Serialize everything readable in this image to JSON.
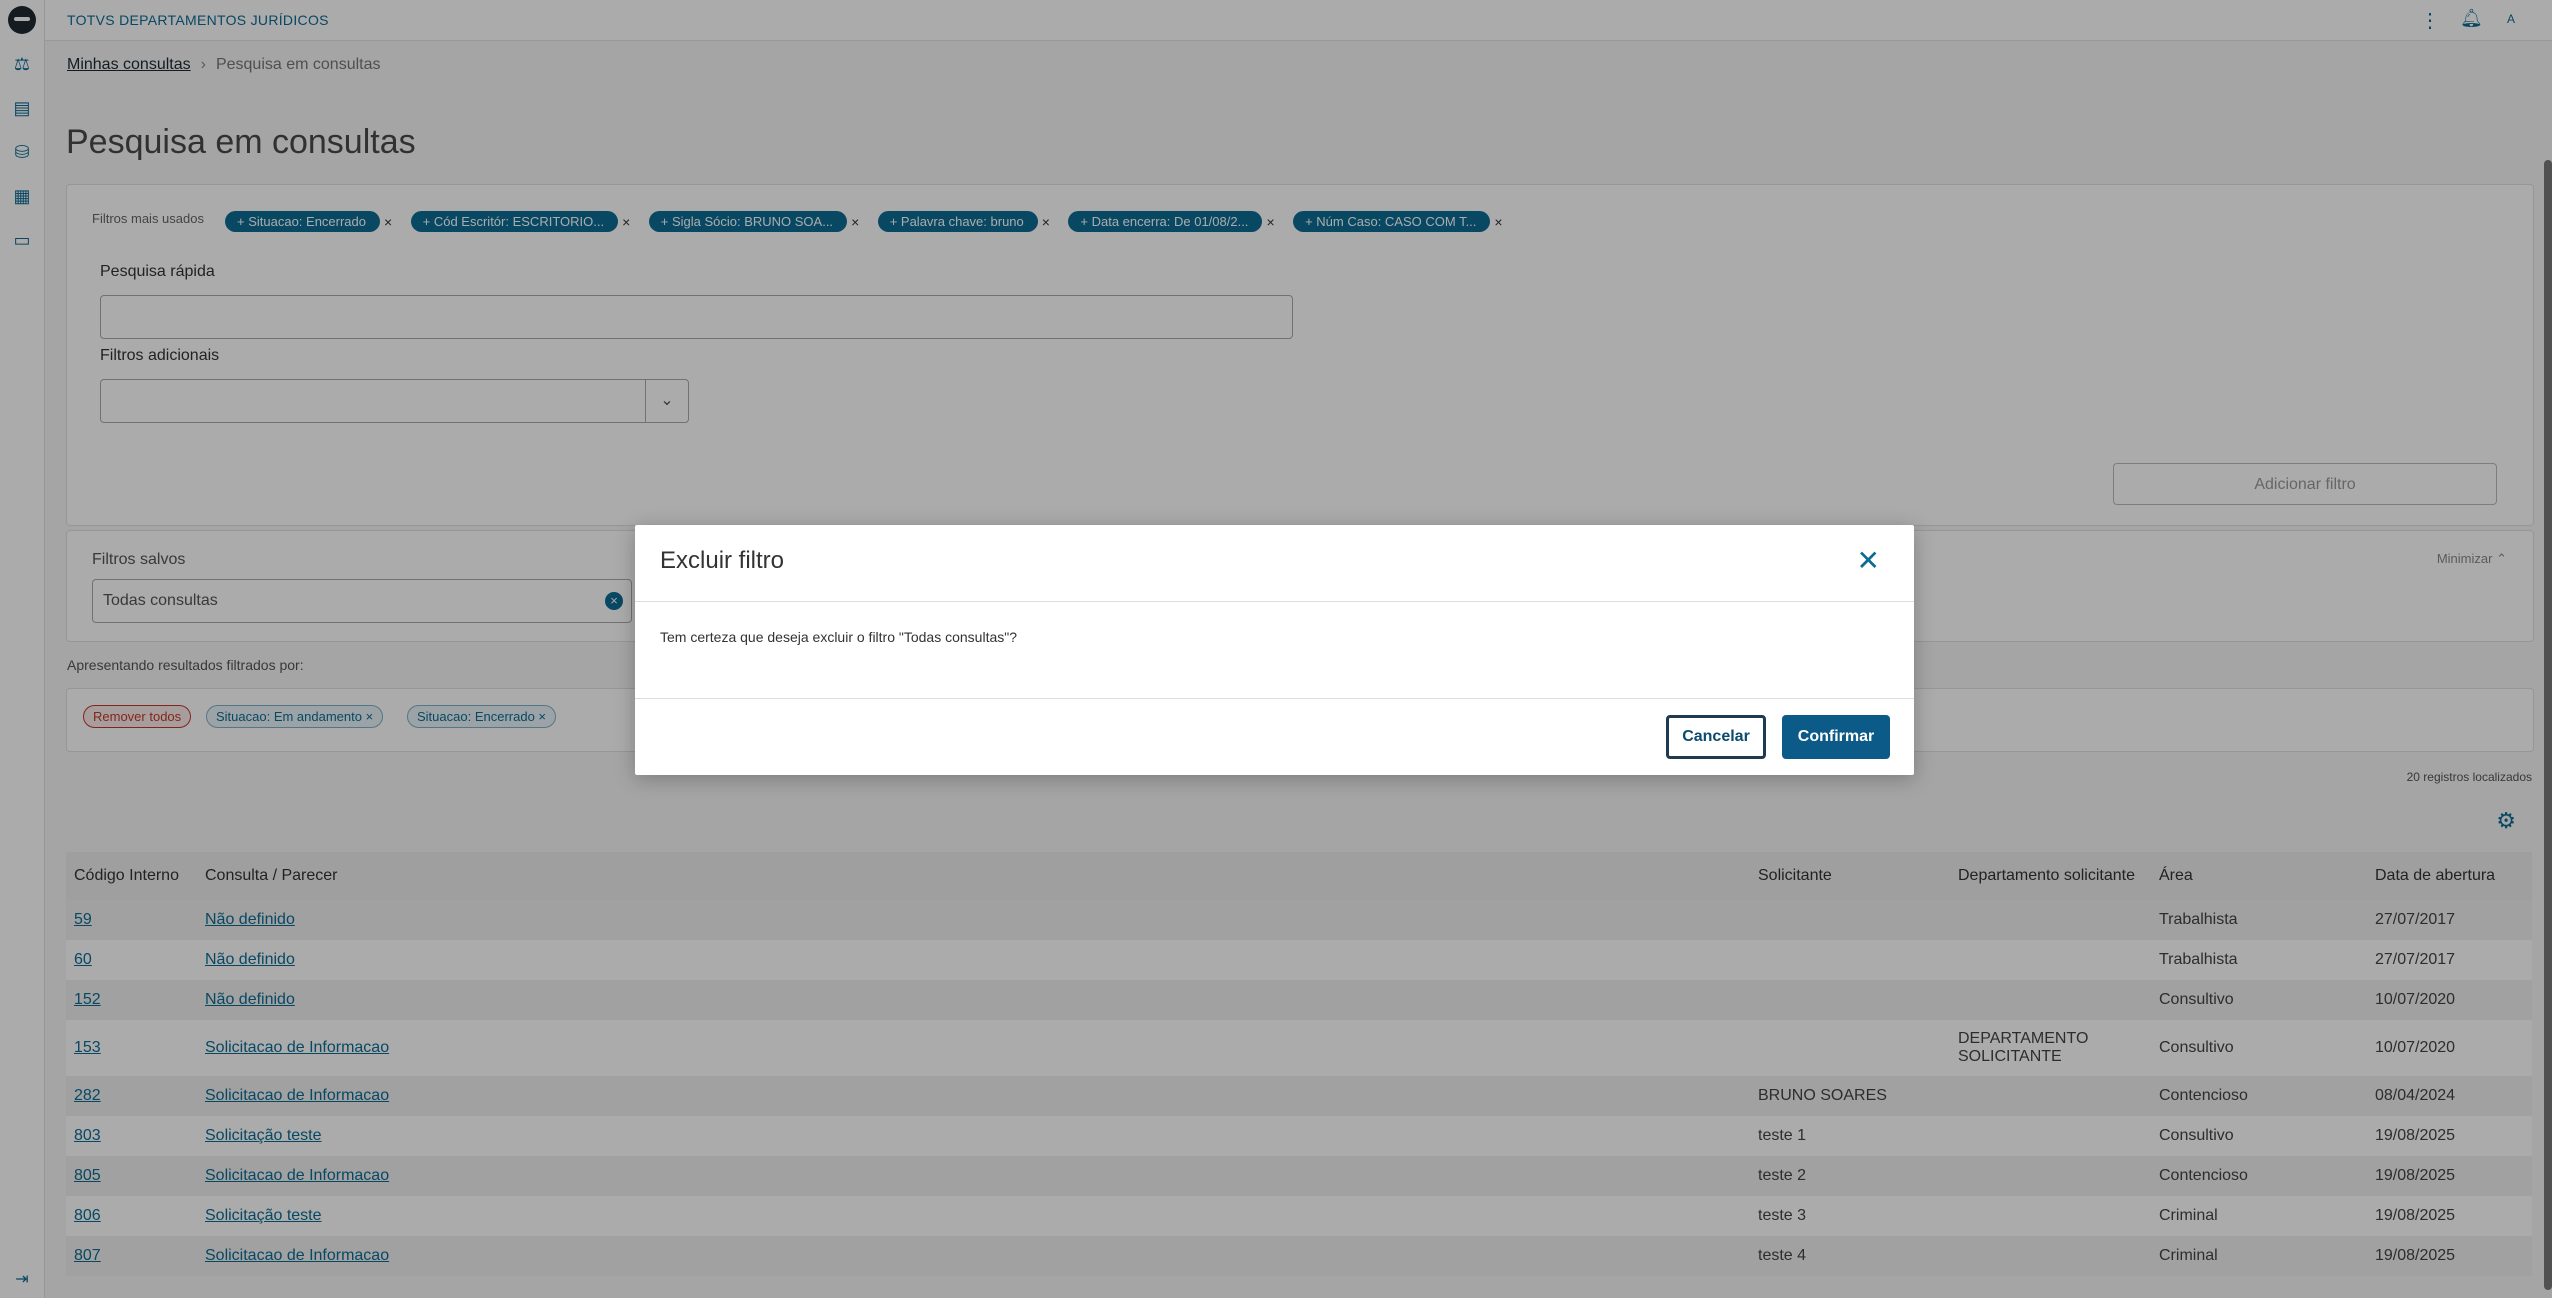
{
  "app": {
    "title": "TOTVS DEPARTAMENTOS JURÍDICOS",
    "user_initial": "A"
  },
  "breadcrumb": {
    "link": "Minhas consultas",
    "current": "Pesquisa em consultas"
  },
  "page_title": "Pesquisa em consultas",
  "filters": {
    "most_used_label": "Filtros mais usados",
    "chips": [
      "+ Situacao: Encerrado",
      "+ Cód Escritór: ESCRITORIO...",
      "+ Sigla Sócio: BRUNO SOA...",
      "+ Palavra chave: bruno",
      "+ Data encerra: De 01/08/2...",
      "+ Núm Caso: CASO COM T..."
    ],
    "quick_search_label": "Pesquisa rápida",
    "quick_search_value": "",
    "additional_label": "Filtros adicionais",
    "additional_value": "",
    "add_button": "Adicionar filtro"
  },
  "saved": {
    "label": "Filtros salvos",
    "value": "Todas consultas",
    "minimize": "Minimizar"
  },
  "results": {
    "label": "Apresentando resultados filtrados por:",
    "remove_all": "Remover todos",
    "chips": [
      "Situacao: Em andamento",
      "Situacao: Encerrado"
    ],
    "count": "20 registros localizados"
  },
  "table": {
    "headers": [
      "Código Interno",
      "Consulta / Parecer",
      "Solicitante",
      "Departamento solicitante",
      "Área",
      "Data de abertura"
    ],
    "rows": [
      [
        "59",
        "Não definido",
        "",
        "",
        "Trabalhista",
        "27/07/2017"
      ],
      [
        "60",
        "Não definido",
        "",
        "",
        "Trabalhista",
        "27/07/2017"
      ],
      [
        "152",
        "Não definido",
        "",
        "",
        "Consultivo",
        "10/07/2020"
      ],
      [
        "153",
        "Solicitacao de Informacao",
        "",
        "DEPARTAMENTO SOLICITANTE",
        "Consultivo",
        "10/07/2020"
      ],
      [
        "282",
        "Solicitacao de Informacao",
        "BRUNO SOARES",
        "",
        "Contencioso",
        "08/04/2024"
      ],
      [
        "803",
        "Solicitação teste",
        "teste 1",
        "",
        "Consultivo",
        "19/08/2025"
      ],
      [
        "805",
        "Solicitacao de Informacao",
        "teste 2",
        "",
        "Contencioso",
        "19/08/2025"
      ],
      [
        "806",
        "Solicitação teste",
        "teste 3",
        "",
        "Criminal",
        "19/08/2025"
      ],
      [
        "807",
        "Solicitacao de Informacao",
        "teste 4",
        "",
        "Criminal",
        "19/08/2025"
      ]
    ]
  },
  "modal": {
    "title": "Excluir filtro",
    "message": "Tem certeza que deseja excluir o filtro \"Todas consultas\"?",
    "cancel": "Cancelar",
    "confirm": "Confirmar"
  },
  "colors": {
    "primary": "#0c6c94",
    "confirm": "#0c5a88",
    "danger": "#c0392b"
  },
  "icons": [
    "scale-icon",
    "report-icon",
    "database-icon",
    "building-icon",
    "document-icon",
    "collapse-menu-icon",
    "more-vertical-icon",
    "bell-icon",
    "gear-icon",
    "close-icon",
    "chevron-down-icon"
  ]
}
